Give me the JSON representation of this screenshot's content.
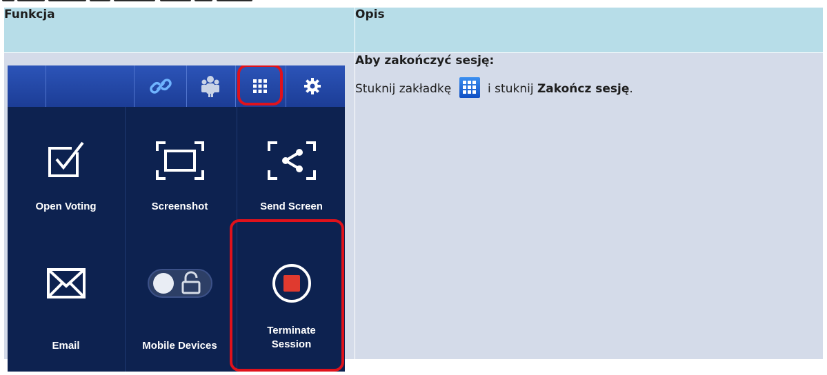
{
  "header": {
    "col1": "Funkcja",
    "col2": "Opis"
  },
  "description": {
    "title": "Aby zakończyć sesję:",
    "line_part1": "Stuknij zakładkę",
    "line_part2": "i stuknij ",
    "line_bold": "Zakończ sesję",
    "line_end": "."
  },
  "app": {
    "tabs": [
      "link-icon",
      "participants-icon",
      "apps-grid-icon",
      "settings-gear-icon"
    ],
    "tiles": [
      {
        "label": "Open Voting",
        "icon": "checkbox-icon"
      },
      {
        "label": "Screenshot",
        "icon": "screenshot-icon"
      },
      {
        "label": "Send Screen",
        "icon": "share-icon"
      },
      {
        "label": "Email",
        "icon": "envelope-icon"
      },
      {
        "label": "Mobile Devices",
        "icon": "lock-toggle-icon"
      },
      {
        "label": "Terminate\nSession",
        "icon": "stop-icon"
      }
    ]
  },
  "colors": {
    "header_bg": "#b7dde8",
    "cell_bg": "#d4dbe9",
    "app_bg": "#0d2250",
    "highlight": "#e0121b"
  }
}
